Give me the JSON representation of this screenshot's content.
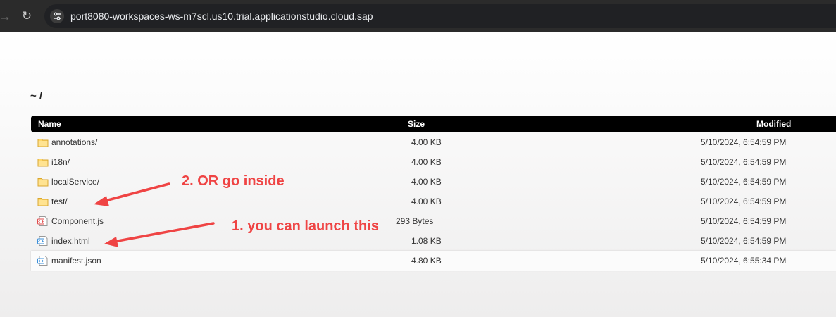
{
  "browser": {
    "url": "port8080-workspaces-ws-m7scl.us10.trial.applicationstudio.cloud.sap"
  },
  "page": {
    "title": "~ /",
    "columns": {
      "name": "Name",
      "size": "Size",
      "modified": "Modified"
    },
    "rows": [
      {
        "name": "annotations/",
        "size": "4.00 KB",
        "modified": "5/10/2024, 6:54:59 PM",
        "icon": "folder-icon"
      },
      {
        "name": "i18n/",
        "size": "4.00 KB",
        "modified": "5/10/2024, 6:54:59 PM",
        "icon": "folder-icon"
      },
      {
        "name": "localService/",
        "size": "4.00 KB",
        "modified": "5/10/2024, 6:54:59 PM",
        "icon": "folder-icon"
      },
      {
        "name": "test/",
        "size": "4.00 KB",
        "modified": "5/10/2024, 6:54:59 PM",
        "icon": "folder-icon"
      },
      {
        "name": "Component.js",
        "size": "293 Bytes",
        "modified": "5/10/2024, 6:54:59 PM",
        "icon": "js-file-icon"
      },
      {
        "name": "index.html",
        "size": "1.08 KB",
        "modified": "5/10/2024, 6:54:59 PM",
        "icon": "html-file-icon"
      },
      {
        "name": "manifest.json",
        "size": "4.80 KB",
        "modified": "5/10/2024, 6:55:34 PM",
        "icon": "json-file-icon"
      }
    ]
  },
  "annotations": {
    "go_inside": "2. OR go inside",
    "launch": "1. you can launch this",
    "color": "#ef4444"
  }
}
